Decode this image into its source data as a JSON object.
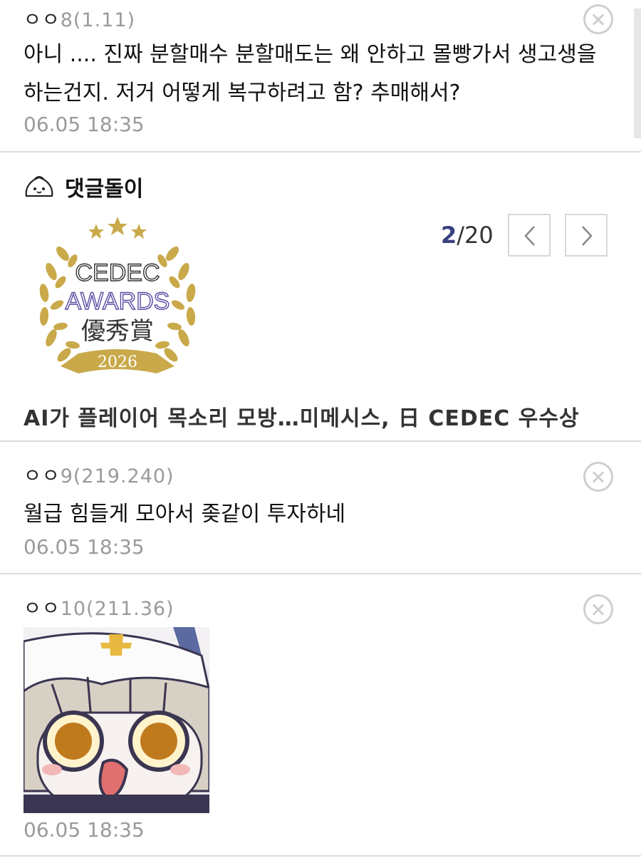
{
  "comments": [
    {
      "nick": "ㅇㅇ",
      "num": "8",
      "ip": "(1.11)",
      "body": "아니 .... 진짜 분할매수 분할매도는 왜 안하고 몰빵가서 생고생을 하는건지. 저거 어떻게 복구하려고 함? 추매해서?",
      "date": "06.05 18:35"
    },
    {
      "nick": "ㅇㅇ",
      "num": "9",
      "ip": "(219.240)",
      "body": "월급 힘들게 모아서 좆같이 투자하네",
      "date": "06.05 18:35"
    },
    {
      "nick": "ㅇㅇ",
      "num": "10",
      "ip": "(211.36)",
      "date": "06.05 18:35"
    }
  ],
  "bot": {
    "title": "댓글돌이",
    "pager_current": "2",
    "pager_total": "/20",
    "headline": "AI가 플레이어 목소리 모방…미메시스, 日 CEDEC 우수상",
    "image": {
      "line1": "CEDEC",
      "line2": "AWARDS",
      "line3": "優秀賞",
      "year": "2026"
    }
  },
  "colors": {
    "accent": "#3a3f80",
    "muted": "#9a9a9a",
    "gold": "#c9a94a"
  }
}
